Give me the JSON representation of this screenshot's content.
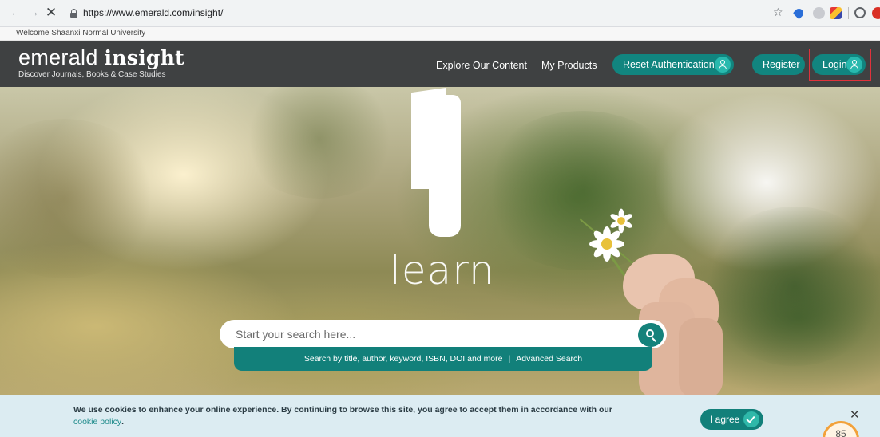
{
  "browser": {
    "back": "←",
    "forward": "→",
    "stop": "✕",
    "url": "https://www.emerald.com/insight/"
  },
  "welcome": "Welcome Shaanxi Normal University",
  "header": {
    "logo_light": "emerald",
    "logo_bold": "insight",
    "tagline": "Discover Journals, Books & Case Studies",
    "nav": {
      "explore": "Explore Our Content",
      "products": "My Products",
      "reset": "Reset Authentication",
      "register": "Register",
      "login": "Login"
    }
  },
  "hero": {
    "word": "learn",
    "search_placeholder": "Start your search here...",
    "search_hint": "Search by title, author, keyword, ISBN, DOI and more",
    "separator": "|",
    "advanced": "Advanced Search"
  },
  "cookie": {
    "message": "We use cookies to enhance your online experience. By continuing to browse this site, you agree to accept them in accordance with our",
    "link": "cookie policy",
    "period": ".",
    "agree": "I agree",
    "close": "✕"
  },
  "badge": "85",
  "colors": {
    "accent": "#12807a",
    "header_bg": "#3f4142",
    "cookie_bg": "#dcecf2",
    "highlight_border": "#e0323c"
  }
}
